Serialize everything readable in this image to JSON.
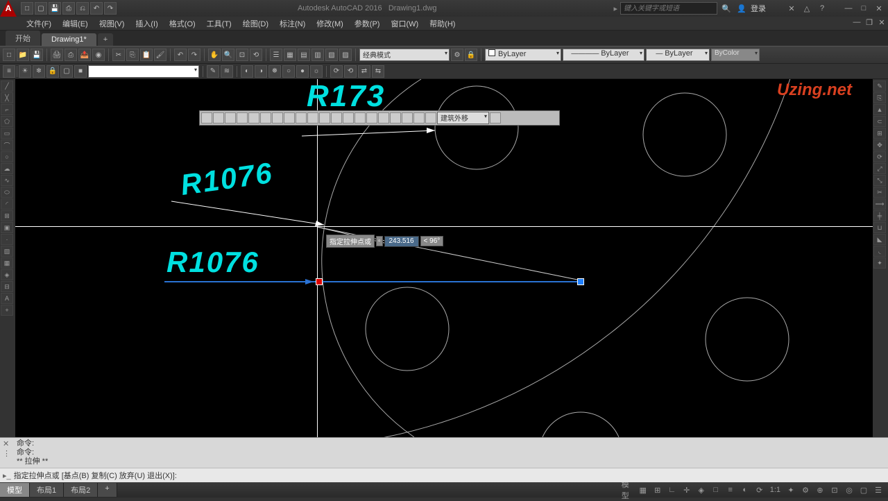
{
  "title": {
    "app": "Autodesk AutoCAD 2016",
    "file": "Drawing1.dwg"
  },
  "search_placeholder": "键入关键字或短语",
  "login": "登录",
  "menus": [
    "文件(F)",
    "编辑(E)",
    "视图(V)",
    "插入(I)",
    "格式(O)",
    "工具(T)",
    "绘图(D)",
    "标注(N)",
    "修改(M)",
    "参数(P)",
    "窗口(W)",
    "帮助(H)"
  ],
  "tabs": {
    "start": "开始",
    "doc": "Drawing1*"
  },
  "layer_dd": "经典模式",
  "prop_dd": [
    "ByLayer",
    "ByLayer",
    "ByLayer",
    "ByColor"
  ],
  "float_dd": "建筑外移",
  "dims": {
    "r173": "R173",
    "r1076a": "R1076",
    "r1076b": "R1076"
  },
  "dyn": {
    "label": "指定拉伸点或",
    "dist": "243.516",
    "angle": "< 96°"
  },
  "cmd": {
    "hist1": "命令:",
    "hist2": "命令:",
    "hist3": "** 拉伸 **",
    "prompt": "指定拉伸点或 [基点(B) 复制(C) 放弃(U) 退出(X)]:"
  },
  "modeltabs": [
    "模型",
    "布局1",
    "布局2",
    "+"
  ],
  "status_scale": "1:1",
  "status_model": "模型",
  "watermark": "Uzing.net"
}
